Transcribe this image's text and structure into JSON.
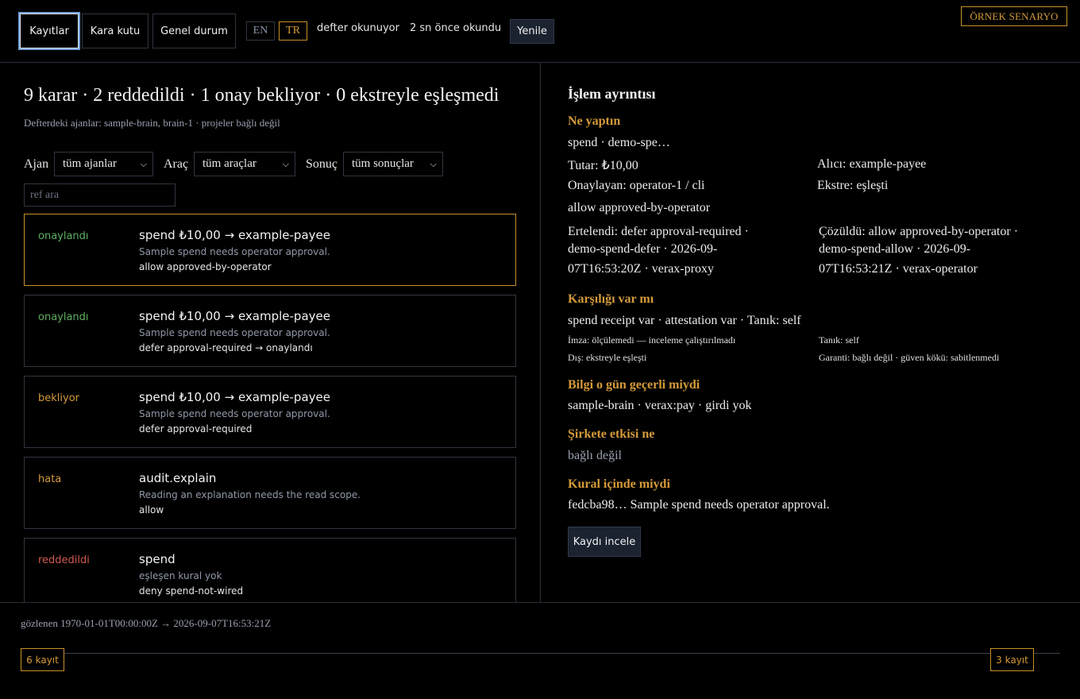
{
  "nav": {
    "tabs": [
      "Kayıtlar",
      "Kara kutu",
      "Genel durum"
    ],
    "lang": [
      "EN",
      "TR"
    ],
    "ledger_status": "defter okunuyor",
    "last_read": "2 sn önce okundu",
    "refresh_label": "Yenile",
    "scenario_badge": "ÖRNEK SENARYO"
  },
  "summary": {
    "headline": "9 karar · 2 reddedildi · 1 onay bekliyor · 0 ekstreyle eşleşmedi",
    "agents_note": "Defterdeki ajanlar: sample-brain, brain-1 · projeler bağlı değil"
  },
  "filters": {
    "agent_label": "Ajan",
    "agent_value": "tüm ajanlar",
    "tool_label": "Araç",
    "tool_value": "tüm araçlar",
    "result_label": "Sonuç",
    "result_value": "tüm sonuçlar",
    "search_placeholder": "ref ara"
  },
  "records": [
    {
      "status": "onaylandı",
      "status_color": "#5fae5f",
      "title": "spend ₺10,00 → example-payee",
      "reason": "Sample spend needs operator approval.",
      "decision": "allow approved-by-operator"
    },
    {
      "status": "onaylandı",
      "status_color": "#5fae5f",
      "title": "spend ₺10,00 → example-payee",
      "reason": "Sample spend needs operator approval.",
      "decision": "defer approval-required → onaylandı"
    },
    {
      "status": "bekliyor",
      "status_color": "#d49a3a",
      "title": "spend ₺10,00 → example-payee",
      "reason": "Sample spend needs operator approval.",
      "decision": "defer approval-required"
    },
    {
      "status": "hata",
      "status_color": "#d49a3a",
      "title": "audit.explain",
      "reason": "Reading an explanation needs the read scope.",
      "decision": "allow"
    },
    {
      "status": "reddedildi",
      "status_color": "#d05a4f",
      "title": "spend",
      "reason": "eşleşen kural yok",
      "decision": "deny spend-not-wired"
    }
  ],
  "detail": {
    "title": "İşlem ayrıntısı",
    "what_head": "Ne yaptın",
    "what": "spend · demo-spe…",
    "amount": "Tutar: ₺10,00",
    "payee": "Alıcı: example-payee",
    "approver": "Onaylayan: operator-1 / cli",
    "statement": "Ekstre: eşleşti",
    "decision": "allow approved-by-operator",
    "deferred_1": "Ertelendi: defer approval-required ·",
    "deferred_2": "demo-spend-defer · 2026-09-",
    "deferred_3": "07T16:53:20Z · verax-proxy",
    "resolved_1": "Çözüldü: allow approved-by-operator ·",
    "resolved_2": "demo-spend-allow · 2026-09-",
    "resolved_3": "07T16:53:21Z · verax-operator",
    "counter_head": "Karşılığı var mı",
    "counter": "spend receipt var · attestation var · Tanık: self",
    "signature": "İmza: ölçülemedi — inceleme çalıştırılmadı",
    "witness": "Tanık: self",
    "external": "Dış: ekstreyle eşleşti",
    "guarantee": "Garanti: bağlı değil · güven kökü: sabitlenmedi",
    "valid_head": "Bilgi o gün geçerli miydi",
    "valid": "sample-brain · verax:pay · girdi yok",
    "impact_head": "Şirkete etkisi ne",
    "impact": "bağlı değil",
    "rule_head": "Kural içinde miydi",
    "rule": "fedcba98… Sample spend needs operator approval.",
    "inspect_label": "Kaydı incele"
  },
  "timeline": {
    "observed": "gözlenen 1970-01-01T00:00:00Z → 2026-09-07T16:53:21Z",
    "left_count": "6 kayıt",
    "right_count": "3 kayıt"
  },
  "colors": {
    "accent": "#d49a3a",
    "approved": "#5fae5f",
    "rejected": "#d05a4f",
    "focus": "#6f9fd8"
  }
}
